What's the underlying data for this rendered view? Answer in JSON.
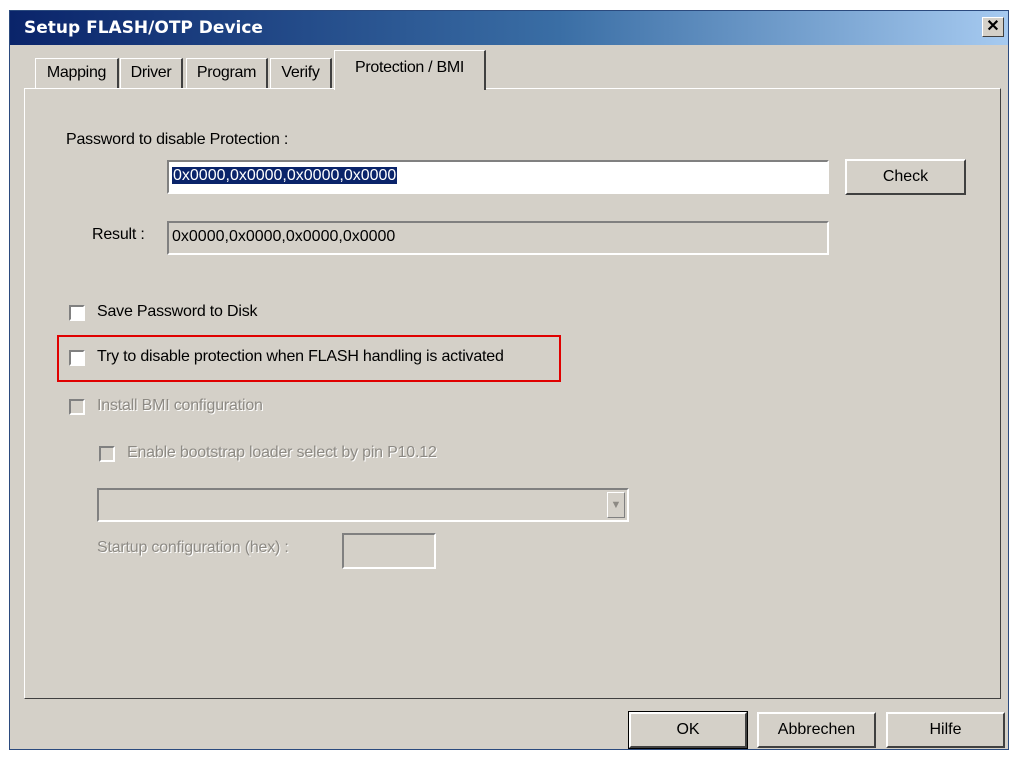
{
  "window": {
    "title": "Setup FLASH/OTP Device",
    "close_glyph": "✕"
  },
  "tabs": [
    {
      "label": "Mapping"
    },
    {
      "label": "Driver"
    },
    {
      "label": "Program"
    },
    {
      "label": "Verify"
    },
    {
      "label": "Protection / BMI"
    }
  ],
  "active_tab": "Protection / BMI",
  "protection": {
    "password_label": "Password to disable Protection :",
    "password_value": "0x0000,0x0000,0x0000,0x0000",
    "check_label": "Check",
    "result_label": "Result :",
    "result_value": "0x0000,0x0000,0x0000,0x0000",
    "save_password_label": "Save Password to Disk",
    "save_password_checked": false,
    "try_disable_label": "Try to disable protection when FLASH handling is activated",
    "try_disable_checked": false
  },
  "bmi": {
    "install_label": "Install BMI configuration",
    "install_checked": false,
    "bootstrap_label": "Enable bootstrap loader select by pin P10.12",
    "bootstrap_checked": false,
    "combo_value": "",
    "startup_label": "Startup configuration (hex) :",
    "startup_value": ""
  },
  "footer": {
    "ok_label": "OK",
    "cancel_label": "Abbrechen",
    "help_label": "Hilfe"
  },
  "colors": {
    "highlight": "#e00000",
    "dialog_bg": "#d4d0c8",
    "title_bar": "#0a246a",
    "selection": "#0a246a"
  },
  "icons": {
    "close": "close-icon",
    "combo_arrow": "chevron-down-icon"
  }
}
